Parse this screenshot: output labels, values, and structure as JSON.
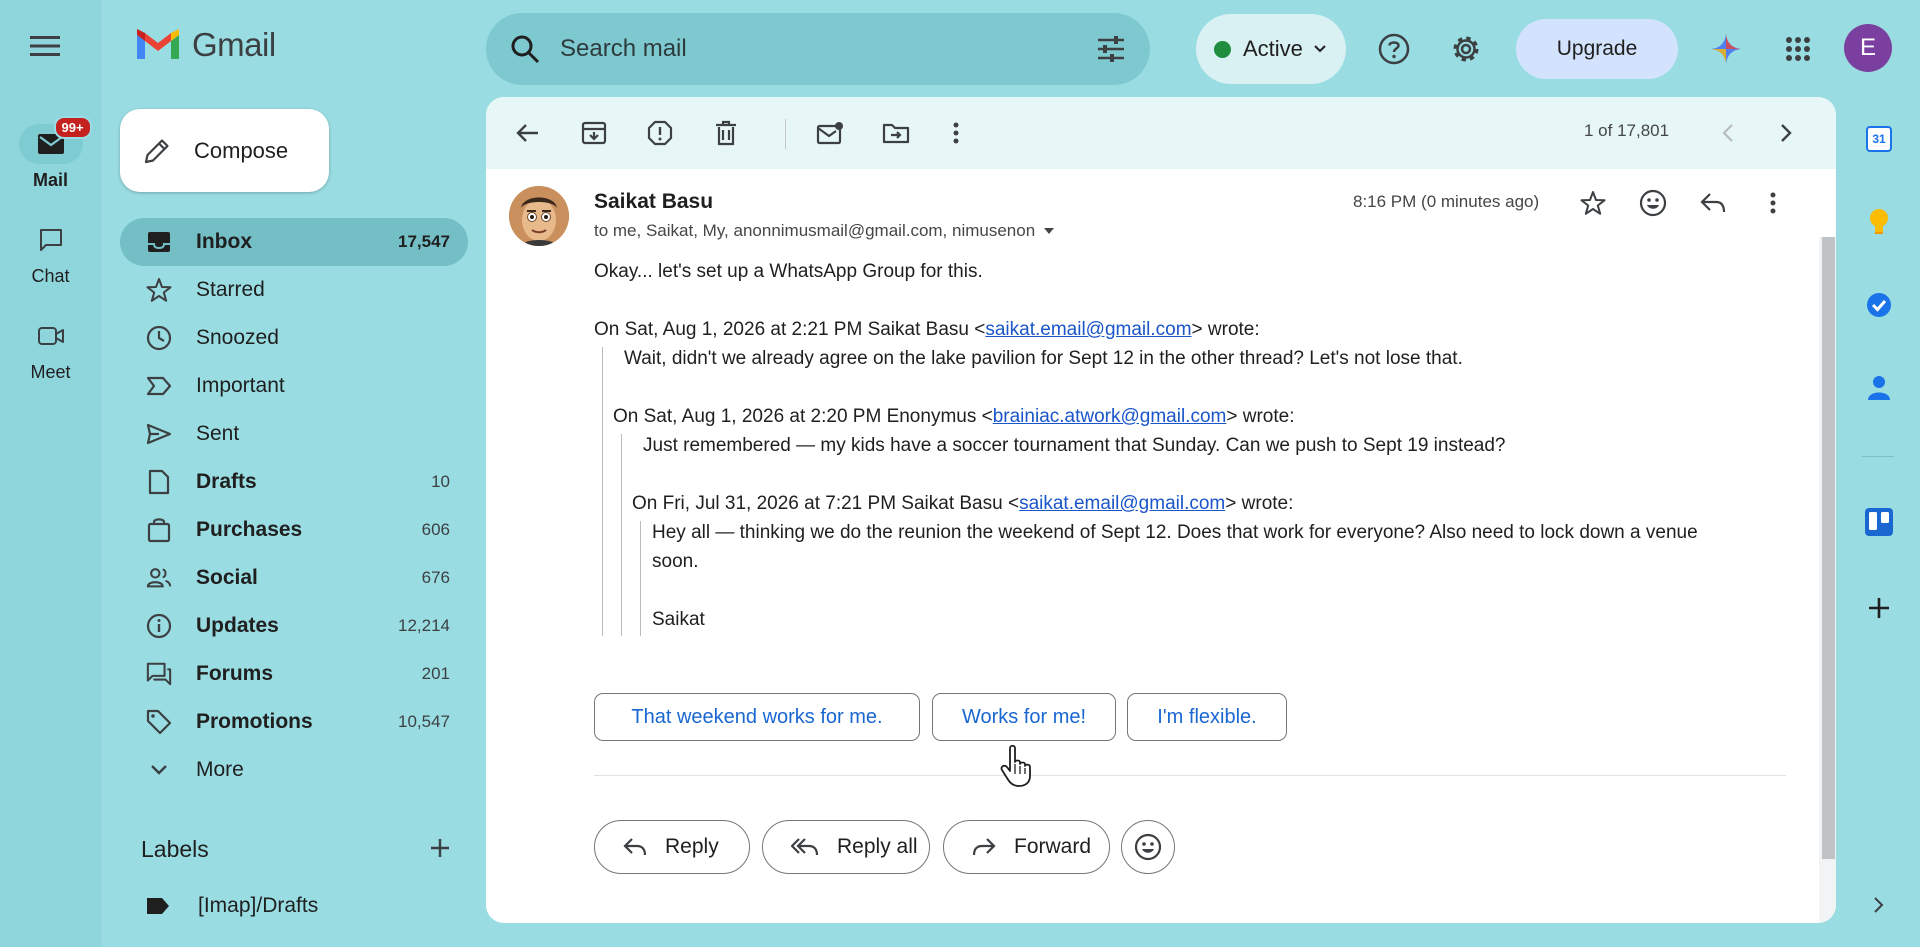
{
  "app": {
    "name": "Gmail"
  },
  "rail": {
    "items": [
      {
        "label": "Mail",
        "badge": "99+"
      },
      {
        "label": "Chat"
      },
      {
        "label": "Meet"
      }
    ]
  },
  "search": {
    "placeholder": "Search mail"
  },
  "header": {
    "status": "Active",
    "upgrade_label": "Upgrade",
    "avatar_letter": "E"
  },
  "compose": {
    "label": "Compose"
  },
  "nav": [
    {
      "label": "Inbox",
      "count": "17,547"
    },
    {
      "label": "Starred",
      "count": ""
    },
    {
      "label": "Snoozed",
      "count": ""
    },
    {
      "label": "Important",
      "count": ""
    },
    {
      "label": "Sent",
      "count": ""
    },
    {
      "label": "Drafts",
      "count": "10"
    },
    {
      "label": "Purchases",
      "count": "606"
    },
    {
      "label": "Social",
      "count": "676"
    },
    {
      "label": "Updates",
      "count": "12,214"
    },
    {
      "label": "Forums",
      "count": "201"
    },
    {
      "label": "Promotions",
      "count": "10,547"
    },
    {
      "label": "More",
      "count": ""
    }
  ],
  "labels": {
    "heading": "Labels",
    "items": [
      "[Imap]/Drafts"
    ]
  },
  "toolbar": {
    "pager": "1 of 17,801"
  },
  "message": {
    "sender": "Saikat Basu",
    "recipients": "to me, Saikat, My, anonnimusmail@gmail.com, nimusenon",
    "time": "8:16 PM (0 minutes ago)",
    "body": "Okay... let's set up a WhatsApp Group for this.",
    "q1_pre": "On Sat, Aug 1, 2026 at 2:21 PM Saikat Basu <",
    "q1_email": "saikat.email@gmail.com",
    "q1_post": "> wrote:",
    "q1_text": "Wait, didn't we already agree on the lake pavilion for Sept 12 in the other thread? Let's not lose that.",
    "q2_pre": "On Sat, Aug 1, 2026 at 2:20 PM Enonymus <",
    "q2_email": "brainiac.atwork@gmail.com",
    "q2_post": "> wrote:",
    "q2_text": "Just remembered — my kids have a soccer tournament that Sunday. Can we push to Sept 19 instead?",
    "q3_pre": "On Fri, Jul 31, 2026 at 7:21 PM Saikat Basu <",
    "q3_email": "saikat.email@gmail.com",
    "q3_post": "> wrote:",
    "q3_text_1": "Hey all — thinking we do the reunion the weekend of Sept 12. Does that work for everyone? Also need to lock down a venue",
    "q3_text_2": "soon.",
    "q3_sign": "Saikat"
  },
  "smart_replies": [
    "That weekend works for me.",
    "Works for me!",
    "I'm flexible."
  ],
  "actions": {
    "reply": "Reply",
    "reply_all": "Reply all",
    "forward": "Forward"
  },
  "side_panel": {
    "calendar_day": "31"
  }
}
